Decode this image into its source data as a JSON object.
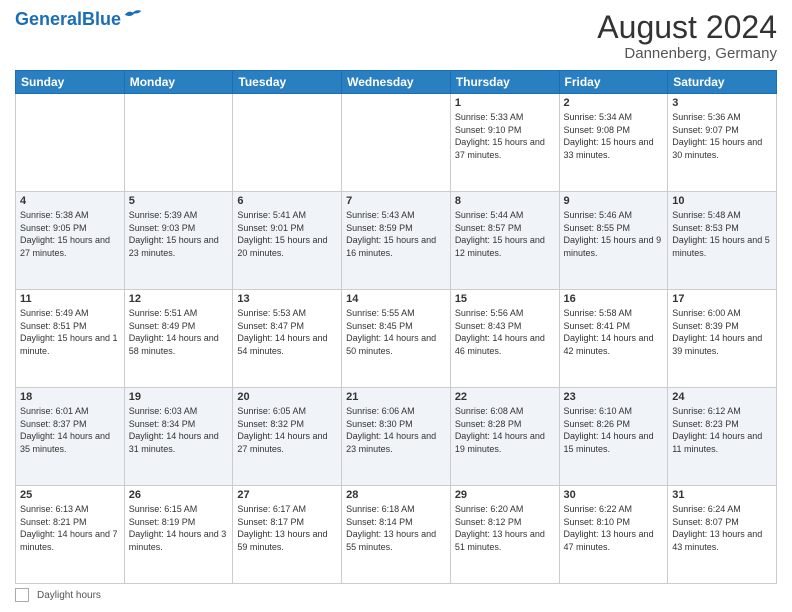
{
  "header": {
    "logo_general": "General",
    "logo_blue": "Blue",
    "month_year": "August 2024",
    "location": "Dannenberg, Germany"
  },
  "days_of_week": [
    "Sunday",
    "Monday",
    "Tuesday",
    "Wednesday",
    "Thursday",
    "Friday",
    "Saturday"
  ],
  "weeks": [
    [
      {
        "day": "",
        "sunrise": "",
        "sunset": "",
        "daylight": ""
      },
      {
        "day": "",
        "sunrise": "",
        "sunset": "",
        "daylight": ""
      },
      {
        "day": "",
        "sunrise": "",
        "sunset": "",
        "daylight": ""
      },
      {
        "day": "",
        "sunrise": "",
        "sunset": "",
        "daylight": ""
      },
      {
        "day": "1",
        "sunrise": "Sunrise: 5:33 AM",
        "sunset": "Sunset: 9:10 PM",
        "daylight": "Daylight: 15 hours and 37 minutes."
      },
      {
        "day": "2",
        "sunrise": "Sunrise: 5:34 AM",
        "sunset": "Sunset: 9:08 PM",
        "daylight": "Daylight: 15 hours and 33 minutes."
      },
      {
        "day": "3",
        "sunrise": "Sunrise: 5:36 AM",
        "sunset": "Sunset: 9:07 PM",
        "daylight": "Daylight: 15 hours and 30 minutes."
      }
    ],
    [
      {
        "day": "4",
        "sunrise": "Sunrise: 5:38 AM",
        "sunset": "Sunset: 9:05 PM",
        "daylight": "Daylight: 15 hours and 27 minutes."
      },
      {
        "day": "5",
        "sunrise": "Sunrise: 5:39 AM",
        "sunset": "Sunset: 9:03 PM",
        "daylight": "Daylight: 15 hours and 23 minutes."
      },
      {
        "day": "6",
        "sunrise": "Sunrise: 5:41 AM",
        "sunset": "Sunset: 9:01 PM",
        "daylight": "Daylight: 15 hours and 20 minutes."
      },
      {
        "day": "7",
        "sunrise": "Sunrise: 5:43 AM",
        "sunset": "Sunset: 8:59 PM",
        "daylight": "Daylight: 15 hours and 16 minutes."
      },
      {
        "day": "8",
        "sunrise": "Sunrise: 5:44 AM",
        "sunset": "Sunset: 8:57 PM",
        "daylight": "Daylight: 15 hours and 12 minutes."
      },
      {
        "day": "9",
        "sunrise": "Sunrise: 5:46 AM",
        "sunset": "Sunset: 8:55 PM",
        "daylight": "Daylight: 15 hours and 9 minutes."
      },
      {
        "day": "10",
        "sunrise": "Sunrise: 5:48 AM",
        "sunset": "Sunset: 8:53 PM",
        "daylight": "Daylight: 15 hours and 5 minutes."
      }
    ],
    [
      {
        "day": "11",
        "sunrise": "Sunrise: 5:49 AM",
        "sunset": "Sunset: 8:51 PM",
        "daylight": "Daylight: 15 hours and 1 minute."
      },
      {
        "day": "12",
        "sunrise": "Sunrise: 5:51 AM",
        "sunset": "Sunset: 8:49 PM",
        "daylight": "Daylight: 14 hours and 58 minutes."
      },
      {
        "day": "13",
        "sunrise": "Sunrise: 5:53 AM",
        "sunset": "Sunset: 8:47 PM",
        "daylight": "Daylight: 14 hours and 54 minutes."
      },
      {
        "day": "14",
        "sunrise": "Sunrise: 5:55 AM",
        "sunset": "Sunset: 8:45 PM",
        "daylight": "Daylight: 14 hours and 50 minutes."
      },
      {
        "day": "15",
        "sunrise": "Sunrise: 5:56 AM",
        "sunset": "Sunset: 8:43 PM",
        "daylight": "Daylight: 14 hours and 46 minutes."
      },
      {
        "day": "16",
        "sunrise": "Sunrise: 5:58 AM",
        "sunset": "Sunset: 8:41 PM",
        "daylight": "Daylight: 14 hours and 42 minutes."
      },
      {
        "day": "17",
        "sunrise": "Sunrise: 6:00 AM",
        "sunset": "Sunset: 8:39 PM",
        "daylight": "Daylight: 14 hours and 39 minutes."
      }
    ],
    [
      {
        "day": "18",
        "sunrise": "Sunrise: 6:01 AM",
        "sunset": "Sunset: 8:37 PM",
        "daylight": "Daylight: 14 hours and 35 minutes."
      },
      {
        "day": "19",
        "sunrise": "Sunrise: 6:03 AM",
        "sunset": "Sunset: 8:34 PM",
        "daylight": "Daylight: 14 hours and 31 minutes."
      },
      {
        "day": "20",
        "sunrise": "Sunrise: 6:05 AM",
        "sunset": "Sunset: 8:32 PM",
        "daylight": "Daylight: 14 hours and 27 minutes."
      },
      {
        "day": "21",
        "sunrise": "Sunrise: 6:06 AM",
        "sunset": "Sunset: 8:30 PM",
        "daylight": "Daylight: 14 hours and 23 minutes."
      },
      {
        "day": "22",
        "sunrise": "Sunrise: 6:08 AM",
        "sunset": "Sunset: 8:28 PM",
        "daylight": "Daylight: 14 hours and 19 minutes."
      },
      {
        "day": "23",
        "sunrise": "Sunrise: 6:10 AM",
        "sunset": "Sunset: 8:26 PM",
        "daylight": "Daylight: 14 hours and 15 minutes."
      },
      {
        "day": "24",
        "sunrise": "Sunrise: 6:12 AM",
        "sunset": "Sunset: 8:23 PM",
        "daylight": "Daylight: 14 hours and 11 minutes."
      }
    ],
    [
      {
        "day": "25",
        "sunrise": "Sunrise: 6:13 AM",
        "sunset": "Sunset: 8:21 PM",
        "daylight": "Daylight: 14 hours and 7 minutes."
      },
      {
        "day": "26",
        "sunrise": "Sunrise: 6:15 AM",
        "sunset": "Sunset: 8:19 PM",
        "daylight": "Daylight: 14 hours and 3 minutes."
      },
      {
        "day": "27",
        "sunrise": "Sunrise: 6:17 AM",
        "sunset": "Sunset: 8:17 PM",
        "daylight": "Daylight: 13 hours and 59 minutes."
      },
      {
        "day": "28",
        "sunrise": "Sunrise: 6:18 AM",
        "sunset": "Sunset: 8:14 PM",
        "daylight": "Daylight: 13 hours and 55 minutes."
      },
      {
        "day": "29",
        "sunrise": "Sunrise: 6:20 AM",
        "sunset": "Sunset: 8:12 PM",
        "daylight": "Daylight: 13 hours and 51 minutes."
      },
      {
        "day": "30",
        "sunrise": "Sunrise: 6:22 AM",
        "sunset": "Sunset: 8:10 PM",
        "daylight": "Daylight: 13 hours and 47 minutes."
      },
      {
        "day": "31",
        "sunrise": "Sunrise: 6:24 AM",
        "sunset": "Sunset: 8:07 PM",
        "daylight": "Daylight: 13 hours and 43 minutes."
      }
    ]
  ],
  "footer": {
    "legend_label": "Daylight hours"
  }
}
